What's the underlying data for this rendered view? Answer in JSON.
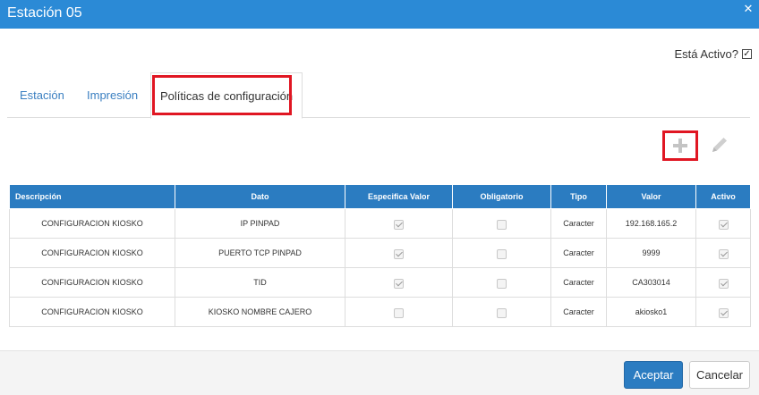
{
  "window": {
    "title": "Estación 05",
    "close_icon": "close-icon"
  },
  "active": {
    "label": "Está Activo?",
    "checked": true
  },
  "tabs": [
    {
      "label": "Estación",
      "active": false
    },
    {
      "label": "Impresión",
      "active": false
    },
    {
      "label": "Políticas de configuración",
      "active": true
    }
  ],
  "toolbar": {
    "add_icon": "plus-icon",
    "edit_icon": "pencil-icon"
  },
  "table": {
    "columns": [
      "Descripción",
      "Dato",
      "Especifica Valor",
      "Obligatorio",
      "Tipo",
      "Valor",
      "Activo"
    ],
    "rows": [
      {
        "descripcion": "CONFIGURACION KIOSKO",
        "dato": "IP PINPAD",
        "especifica_valor": true,
        "obligatorio": false,
        "tipo": "Caracter",
        "valor": "192.168.165.2",
        "activo": true
      },
      {
        "descripcion": "CONFIGURACION KIOSKO",
        "dato": "PUERTO TCP PINPAD",
        "especifica_valor": true,
        "obligatorio": false,
        "tipo": "Caracter",
        "valor": "9999",
        "activo": true
      },
      {
        "descripcion": "CONFIGURACION KIOSKO",
        "dato": "TID",
        "especifica_valor": true,
        "obligatorio": false,
        "tipo": "Caracter",
        "valor": "CA303014",
        "activo": true
      },
      {
        "descripcion": "CONFIGURACION KIOSKO",
        "dato": "KIOSKO NOMBRE CAJERO",
        "especifica_valor": false,
        "obligatorio": false,
        "tipo": "Caracter",
        "valor": "akiosko1",
        "activo": true
      }
    ]
  },
  "footer": {
    "ok_label": "Aceptar",
    "cancel_label": "Cancelar"
  },
  "colors": {
    "header": "#2b8ad6",
    "table_header": "#2b7cc1",
    "highlight": "#e01622",
    "primary_button": "#2b7cc1"
  }
}
